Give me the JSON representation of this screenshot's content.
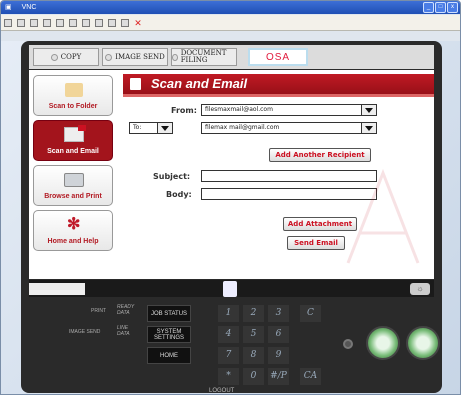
{
  "window": {
    "title": "VNC"
  },
  "toolbar": {
    "close_symbol": "✕"
  },
  "tabs": [
    {
      "label": "COPY"
    },
    {
      "label": "IMAGE SEND"
    },
    {
      "label": "DOCUMENT FILING"
    },
    {
      "label": "OSA"
    }
  ],
  "sidebar": {
    "items": [
      {
        "label": "Scan to Folder"
      },
      {
        "label": "Scan and Email"
      },
      {
        "label": "Browse and Print"
      },
      {
        "label": "Home and Help"
      }
    ]
  },
  "form": {
    "title": "Scan and Email",
    "from_label": "From:",
    "from_value": "filesmaxmail@aol.com",
    "to_option": "To:",
    "to_value": "filemax mail@gmail.com",
    "add_recipient": "Add Another Recipient",
    "subject_label": "Subject:",
    "subject_value": "",
    "body_label": "Body:",
    "body_value": "",
    "add_attachment": "Add Attachment",
    "send_email": "Send Email"
  },
  "panel": {
    "print": "PRINT",
    "ready": "READY",
    "data": "DATA",
    "image_send": "IMAGE SEND",
    "line": "LINE",
    "data2": "DATA",
    "job_status": "JOB STATUS",
    "system_settings": "SYSTEM SETTINGS",
    "home": "HOME",
    "logout": "LOGOUT",
    "keys": [
      "1",
      "2",
      "3",
      "C",
      "4",
      "5",
      "6",
      "7",
      "8",
      "9",
      "*",
      "0",
      "#/P",
      "CA"
    ]
  },
  "colors": {
    "accent": "#b3151d",
    "brand": "#e01a3c"
  }
}
